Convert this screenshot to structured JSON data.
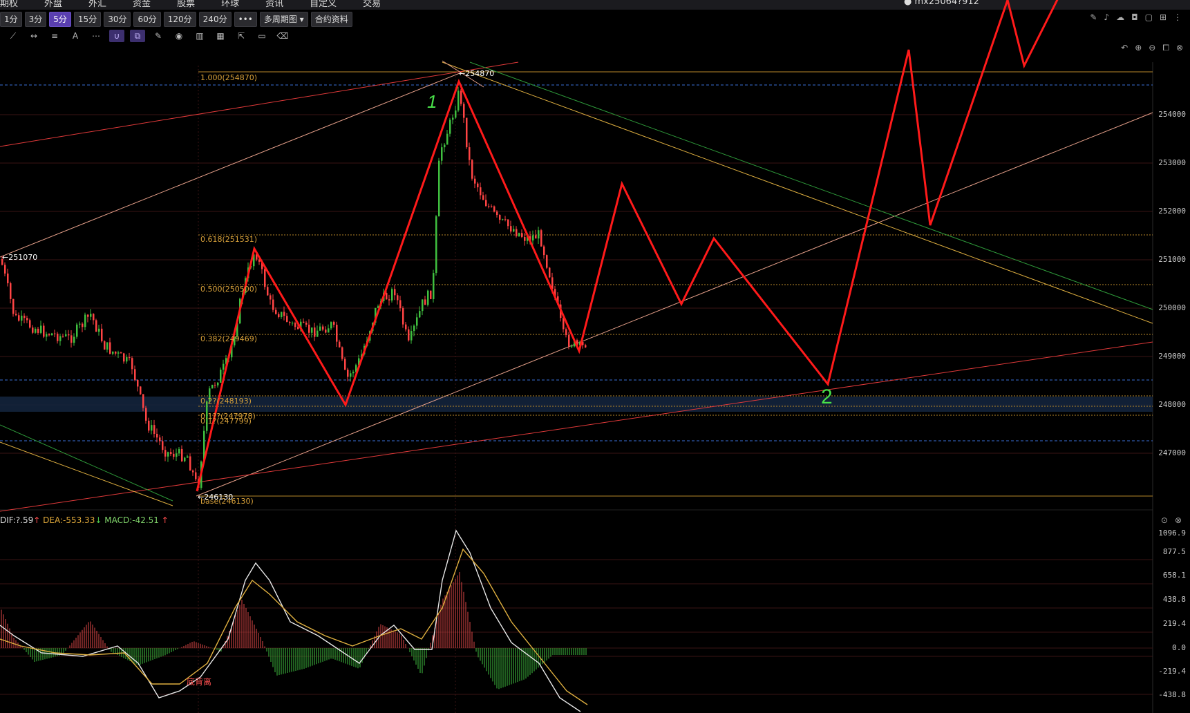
{
  "topbar": {
    "menu": [
      "期权",
      "外盘",
      "外汇",
      "资金",
      "股票",
      "环球",
      "资讯",
      "自定义",
      "交易"
    ],
    "user": "mx25064?912"
  },
  "toolbar": {
    "timeframes": [
      "1分",
      "3分",
      "5分",
      "15分",
      "30分",
      "60分",
      "120分",
      "240分"
    ],
    "active_timeframe": "5分",
    "more_label": "•••",
    "multi_period": "多周期图",
    "contract_info": "合约资料"
  },
  "main_chart": {
    "y_labels": [
      "254000",
      "253000",
      "252000",
      "251000",
      "250000",
      "249000",
      "248000",
      "247000"
    ],
    "fib_levels": [
      {
        "label": "1.000(254870)"
      },
      {
        "label": "0.618(251531)"
      },
      {
        "label": "0.500(250500)"
      },
      {
        "label": "0.382(249469)"
      },
      {
        "label": "0.2?(248193)"
      },
      {
        "label": "0.1??(247978)"
      },
      {
        "label": "0.1?(247799)"
      },
      {
        "label": "base(246130)"
      }
    ],
    "marks": {
      "high": "254870",
      "low": "246130",
      "left": "251070"
    },
    "annotations": {
      "wave1": "1",
      "wave2": "2"
    },
    "colors": {
      "projection": "#ff1a1a",
      "candle_up": "#3fbf3f",
      "fib": "#d9a23a",
      "grid": "#3a1414"
    }
  },
  "macd": {
    "dif_label": "DIF:?.59",
    "dea_label": "DEA:-553.33",
    "macd_label": "MACD:-42.51",
    "y_labels": [
      "1096.9",
      "877.5",
      "658.1",
      "438.8",
      "219.4",
      "0.0",
      "-219.4",
      "-438.8"
    ],
    "divergence_label": "底背离"
  }
}
